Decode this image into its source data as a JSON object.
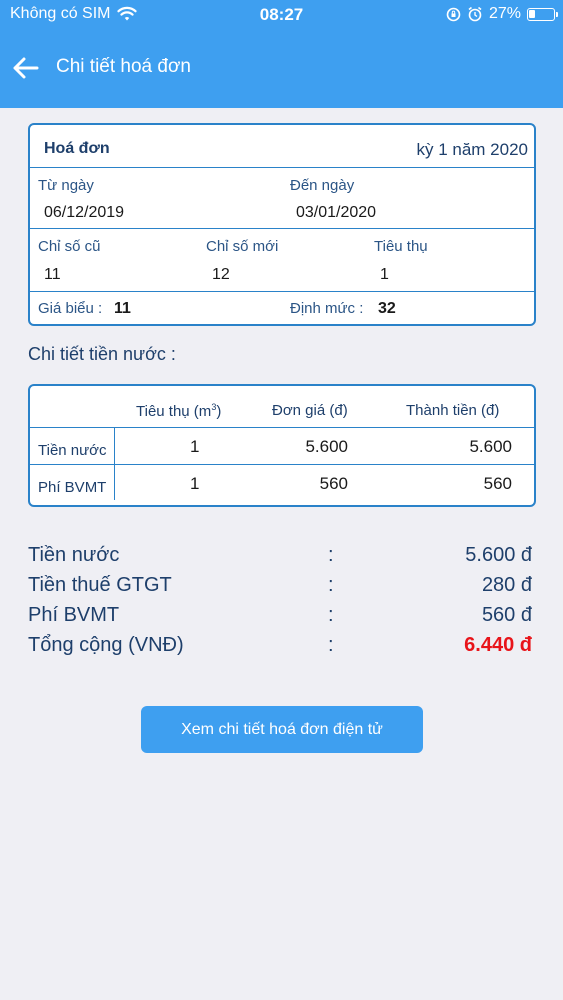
{
  "status_bar": {
    "carrier": "Không có SIM",
    "time": "08:27",
    "battery": "27%",
    "battery_level": 0.27
  },
  "nav": {
    "title": "Chi tiết hoá đơn",
    "back_icon": "arrow-left-icon"
  },
  "invoice": {
    "label": "Hoá đơn",
    "period": "kỳ 1 năm 2020",
    "from_label": "Từ ngày",
    "from_value": "06/12/2019",
    "to_label": "Đến ngày",
    "to_value": "03/01/2020",
    "old_index_label": "Chỉ số cũ",
    "old_index_value": "11",
    "new_index_label": "Chỉ số mới",
    "new_index_value": "12",
    "consumption_label": "Tiêu thụ",
    "consumption_value": "1",
    "price_table_label": "Giá biểu :",
    "price_table_value": "11",
    "quota_label": "Định mức :",
    "quota_value": "32"
  },
  "detail": {
    "title": "Chi tiết tiền nước :",
    "headers": [
      "Tiêu thụ (m",
      "3",
      ")",
      "Đơn giá (đ)",
      "Thành tiền (đ)"
    ],
    "rows": [
      {
        "name": "Tiền nước",
        "consumption": "1",
        "unit_price": "5.600",
        "amount": "5.600"
      },
      {
        "name": "Phí BVMT",
        "consumption": "1",
        "unit_price": "560",
        "amount": "560"
      }
    ]
  },
  "summary": [
    {
      "label": "Tiền nước",
      "colon": ":",
      "value": "5.600 đ"
    },
    {
      "label": "Tiền thuế GTGT",
      "colon": ":",
      "value": "280 đ"
    },
    {
      "label": "Phí BVMT",
      "colon": ":",
      "value": "560 đ"
    },
    {
      "label": "Tổng cộng (VNĐ)",
      "colon": ":",
      "value": "6.440 đ"
    }
  ],
  "button": {
    "label": "Xem chi tiết hoá đơn điện tử"
  },
  "colors": {
    "primary": "#3e9ff0",
    "border": "#2a82c9",
    "total": "#e8141a",
    "background": "#efeff4"
  }
}
